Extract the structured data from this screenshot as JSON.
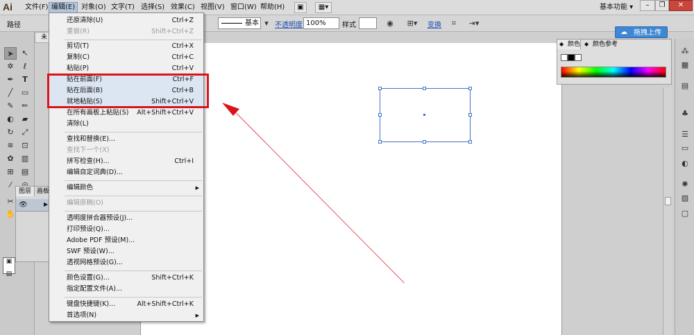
{
  "app": {
    "logo": "Ai"
  },
  "menubar": {
    "items": [
      "文件(F)",
      "编辑(E)",
      "对象(O)",
      "文字(T)",
      "选择(S)",
      "效果(C)",
      "视图(V)",
      "窗口(W)",
      "帮助(H)"
    ],
    "workspace": "基本功能"
  },
  "controlbar": {
    "path_label": "路径",
    "stroke_style": "基本",
    "opacity_label": "不透明度",
    "opacity_value": "100%",
    "style_label": "样式",
    "transform_label": "变换"
  },
  "upload_button": "拖拽上传",
  "document_tab": "未",
  "layers_panel": {
    "tab1": "图层",
    "tab2": "画板"
  },
  "color_panel": {
    "tab1": "颜色",
    "tab2": "颜色参考"
  },
  "edit_menu": {
    "items": [
      {
        "label": "还原清除(U)",
        "shortcut": "Ctrl+Z"
      },
      {
        "label": "重做(R)",
        "shortcut": "Shift+Ctrl+Z",
        "disabled": true
      },
      {
        "label": "剪切(T)",
        "shortcut": "Ctrl+X"
      },
      {
        "label": "复制(C)",
        "shortcut": "Ctrl+C"
      },
      {
        "label": "粘贴(P)",
        "shortcut": "Ctrl+V"
      },
      {
        "label": "贴在前面(F)",
        "shortcut": "Ctrl+F"
      },
      {
        "label": "贴在后面(B)",
        "shortcut": "Ctrl+B"
      },
      {
        "label": "就地粘贴(S)",
        "shortcut": "Shift+Ctrl+V"
      },
      {
        "label": "在所有画板上粘贴(S)",
        "shortcut": "Alt+Shift+Ctrl+V"
      },
      {
        "label": "清除(L)",
        "shortcut": ""
      },
      {
        "label": "查找和替换(E)...",
        "shortcut": ""
      },
      {
        "label": "查找下一个(X)",
        "shortcut": "",
        "disabled": true
      },
      {
        "label": "拼写检查(H)...",
        "shortcut": "Ctrl+I"
      },
      {
        "label": "编辑自定词典(D)...",
        "shortcut": ""
      },
      {
        "label": "编辑颜色",
        "shortcut": "",
        "submenu": true
      },
      {
        "label": "编辑原稿(O)",
        "shortcut": "",
        "disabled": true
      },
      {
        "label": "透明度拼合器预设(J)...",
        "shortcut": ""
      },
      {
        "label": "打印预设(Q)...",
        "shortcut": ""
      },
      {
        "label": "Adobe PDF 预设(M)...",
        "shortcut": ""
      },
      {
        "label": "SWF 预设(W)...",
        "shortcut": ""
      },
      {
        "label": "透视网格预设(G)...",
        "shortcut": ""
      },
      {
        "label": "颜色设置(G)...",
        "shortcut": "Shift+Ctrl+K"
      },
      {
        "label": "指定配置文件(A)...",
        "shortcut": ""
      },
      {
        "label": "键盘快捷键(K)...",
        "shortcut": "Alt+Shift+Ctrl+K"
      },
      {
        "label": "首选项(N)",
        "shortcut": "",
        "submenu": true
      }
    ]
  },
  "icons": {
    "selection": "➤",
    "direct_select": "↖",
    "magic_wand": "✲",
    "lasso": "ℓ",
    "pen": "✒",
    "type": "T",
    "line": "╱",
    "rectangle": "▭",
    "brush": "✎",
    "pencil": "✏",
    "blob": "◐",
    "eraser": "▰",
    "rotate": "↻",
    "scale": "⤢",
    "warp": "≋",
    "free_transform": "⊡",
    "symbol": "✿",
    "graph": "▥",
    "mesh": "⊞",
    "gradient": "▤",
    "eyedropper": "⁄",
    "blend": "◎",
    "scissors": "✂",
    "artboard": "⊏",
    "hand": "✋",
    "zoom": "⌕",
    "eye": "👁",
    "dock1": "⁂",
    "dock2": "▦",
    "dock3": "▤",
    "dock4": "♣",
    "dock5": "☰",
    "dock6": "▭",
    "dock7": "◐",
    "dock8": "✺",
    "dock9": "▧",
    "dock10": "▢"
  }
}
